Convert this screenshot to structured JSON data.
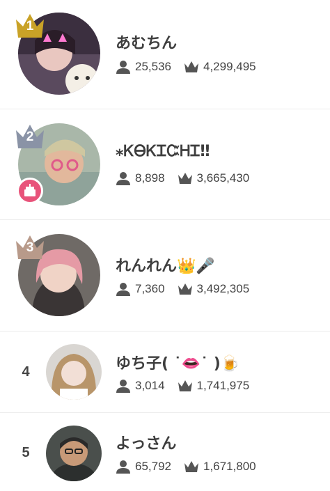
{
  "ranking": [
    {
      "rank": "1",
      "name": "あむちん",
      "followers": "25,536",
      "points": "4,299,495",
      "medal": "gold"
    },
    {
      "rank": "2",
      "name": "⁎ᏦᎾᏦᏆᏨᎻᏆ‼︎",
      "followers": "8,898",
      "points": "3,665,430",
      "medal": "silver"
    },
    {
      "rank": "3",
      "name": "れんれん👑🎤",
      "followers": "7,360",
      "points": "3,492,305",
      "medal": "bronze"
    },
    {
      "rank": "4",
      "name": "ゆち子( ˙👄˙ )🍺",
      "followers": "3,014",
      "points": "1,741,975"
    },
    {
      "rank": "5",
      "name": "よっさん",
      "followers": "65,792",
      "points": "1,671,800"
    }
  ],
  "colors": {
    "gold": "#c9a227",
    "silver": "#8a93a6",
    "bronze": "#b89a8a",
    "birthday_badge": "#e8537a"
  },
  "icons": {
    "followers": "person-icon",
    "points": "crown-icon",
    "badge": "birthday-cake-icon"
  }
}
